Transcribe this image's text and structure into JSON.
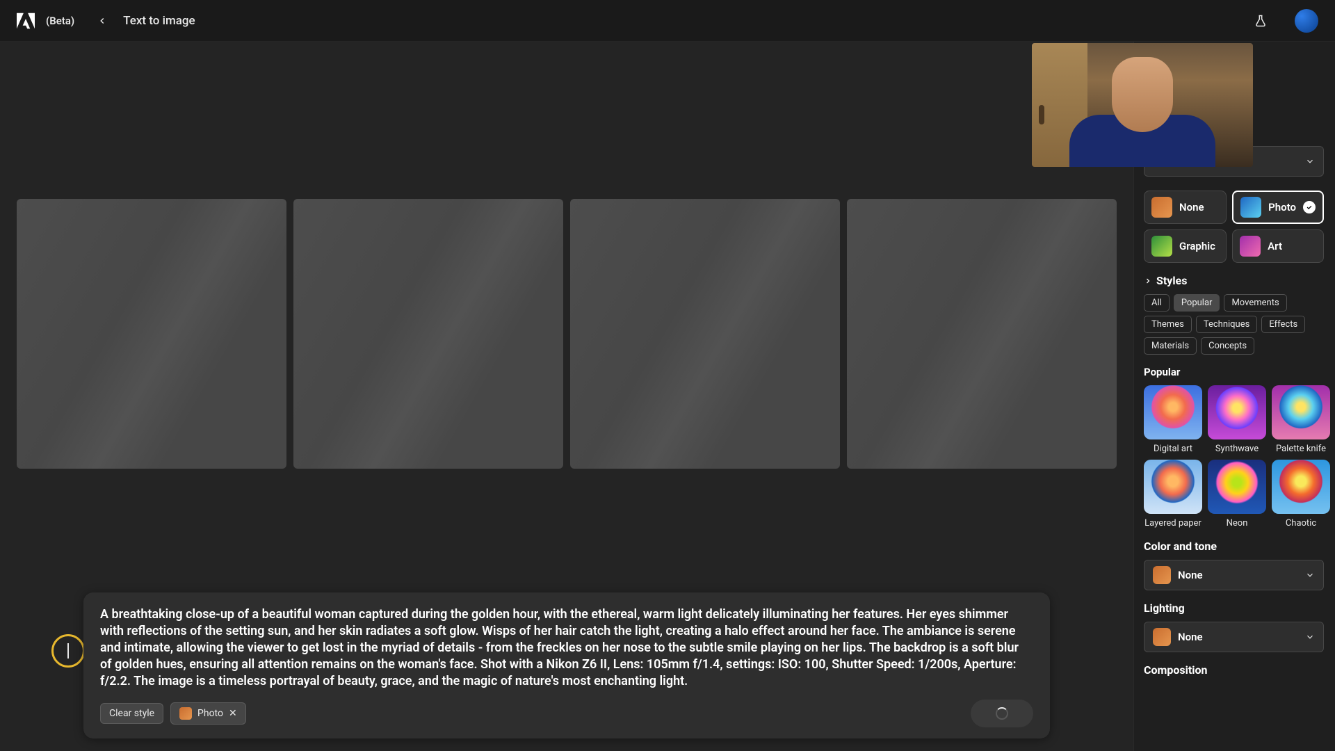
{
  "header": {
    "beta": "(Beta)",
    "title": "Text to image"
  },
  "prompt": {
    "text": "A breathtaking close-up of a beautiful woman captured during the golden hour, with the ethereal, warm light delicately illuminating her features. Her eyes shimmer with reflections of the setting sun, and her skin radiates a soft glow. Wisps of her hair catch the light, creating a halo effect around her face. The ambiance is serene and intimate, allowing the viewer to get lost in the myriad of details - from the freckles on her nose to the subtle smile playing on her lips. The backdrop is a soft blur of golden hues, ensuring all attention remains on the woman's face. Shot with a Nikon Z6 II, Lens: 105mm f/1.4, settings: ISO: 100, Shutter Speed: 1/200s, Aperture: f/2.2. The image is a timeless portrayal of beauty, grace, and the magic of nature's most enchanting light.",
    "clear_style": "Clear style",
    "tag_photo": "Photo"
  },
  "sidebar": {
    "content_type": {
      "none": "None",
      "photo": "Photo",
      "graphic": "Graphic",
      "art": "Art"
    },
    "styles_header": "Styles",
    "style_tabs": [
      "All",
      "Popular",
      "Movements",
      "Themes",
      "Techniques",
      "Effects",
      "Materials",
      "Concepts"
    ],
    "style_tabs_selected": "Popular",
    "popular_label": "Popular",
    "styles": [
      {
        "name": "Digital art",
        "cls": "th-da"
      },
      {
        "name": "Synthwave",
        "cls": "th-sw"
      },
      {
        "name": "Palette knife",
        "cls": "th-pk"
      },
      {
        "name": "Layered paper",
        "cls": "th-lp"
      },
      {
        "name": "Neon",
        "cls": "th-ne"
      },
      {
        "name": "Chaotic",
        "cls": "th-ch"
      }
    ],
    "color_tone": {
      "header": "Color and tone",
      "value": "None"
    },
    "lighting": {
      "header": "Lighting",
      "value": "None"
    },
    "composition": {
      "header": "Composition"
    }
  }
}
